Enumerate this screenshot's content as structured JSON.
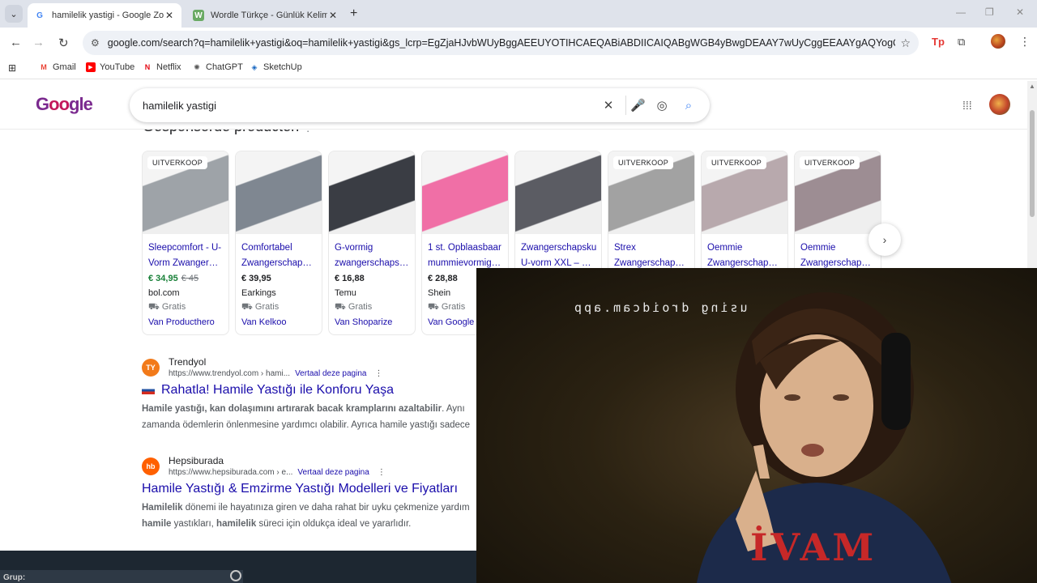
{
  "browser": {
    "tabs": [
      {
        "title": "hamilelik yastigi - Google Zoek",
        "active": true
      },
      {
        "title": "Wordle Türkçe - Günlük Kelime",
        "active": false
      }
    ],
    "url": "google.com/search?q=hamilelik+yastigi&oq=hamilelik+yastigi&gs_lcrp=EgZjaHJvbWUyBggAEEUYOTIHCAEQABiABDIICAIQABgWGB4yBwgDEAAY7wUyCggEEAAYgAQYogQyCggFEAAYgA...",
    "bookmarks": [
      {
        "label": "Gmail"
      },
      {
        "label": "YouTube"
      },
      {
        "label": "Netflix"
      },
      {
        "label": "ChatGPT"
      },
      {
        "label": "SketchUp"
      }
    ]
  },
  "google": {
    "query": "hamilelik yastigi",
    "sponsored_heading": "Gesponsorde producten",
    "products": [
      {
        "badge": "UITVERKOOP",
        "title": "Sleepcomfort - U-Vorm Zwanger…",
        "price": "€ 34,95",
        "old_price": "€ 45",
        "store": "bol.com",
        "shipping": "Gratis",
        "via": "Van Producthero",
        "color": "#9ea3a8"
      },
      {
        "badge": "",
        "title": "Comfortabel Zwangerschap…",
        "price": "€ 39,95",
        "old_price": "",
        "store": "Earkings",
        "shipping": "Gratis",
        "via": "Van Kelkoo",
        "color": "#7f8791"
      },
      {
        "badge": "",
        "title": "G-vormig zwangerschaps…",
        "price": "€ 16,88",
        "old_price": "",
        "store": "Temu",
        "shipping": "Gratis",
        "via": "Van Shoparize",
        "color": "#3a3d44"
      },
      {
        "badge": "",
        "title": "1 st. Opblaasbaar mummievormig…",
        "price": "€ 28,88",
        "old_price": "",
        "store": "Shein",
        "shipping": "Gratis",
        "via": "Van Google",
        "color": "#f06fa6"
      },
      {
        "badge": "",
        "title": "Zwangerschapsku U-vorm XXL – …",
        "price": "",
        "old_price": "",
        "store": "",
        "shipping": "",
        "via": "",
        "color": "#5b5c63"
      },
      {
        "badge": "UITVERKOOP",
        "title": "Strex Zwangerschap…",
        "price": "",
        "old_price": "",
        "store": "",
        "shipping": "",
        "via": "",
        "color": "#a2a2a2"
      },
      {
        "badge": "UITVERKOOP",
        "title": "Oemmie Zwangerschap…",
        "price": "",
        "old_price": "",
        "store": "",
        "shipping": "",
        "via": "",
        "color": "#b8a9ad"
      },
      {
        "badge": "UITVERKOOP",
        "title": "Oemmie Zwangerschap…",
        "price": "",
        "old_price": "",
        "store": "",
        "shipping": "",
        "via": "",
        "color": "#9d8d93"
      }
    ],
    "results": [
      {
        "site": "Trendyol",
        "url": "https://www.trendyol.com › hami...",
        "translate": "Vertaal deze pagina",
        "title": "Rahatla! Hamile Yastığı ile Konforu Yaşa",
        "snippet_bold": "Hamile yastığı, kan dolaşımını artırarak bacak kramplarını azaltabilir",
        "snippet_rest": ". Aynı",
        "snippet_line2": "zamanda ödemlerin önlenmesine yardımcı olabilir. Ayrıca hamile yastığı sadece",
        "fav_color": "#f27a1a",
        "fav_text": "TY"
      },
      {
        "site": "Hepsiburada",
        "url": "https://www.hepsiburada.com › e...",
        "translate": "Vertaal deze pagina",
        "title": "Hamile Yastığı & Emzirme Yastığı Modelleri ve Fiyatları",
        "snippet_bold": "Hamilelik",
        "snippet_rest": " dönemi ile hayatınıza giren ve daha rahat bir uyku çekmenize yardım",
        "snippet_line2_bold1": "hamile",
        "snippet_line2_mid": " yastıkları, ",
        "snippet_line2_bold2": "hamilelik",
        "snippet_line2_end": " süreci için oldukça ideal ve yararlıdır.",
        "fav_color": "#ff6000",
        "fav_text": "hb"
      }
    ]
  },
  "taskbar": {
    "label": "Grup:"
  },
  "webcam": {
    "watermark": "using droidcam.app",
    "hoodie_text": "İVAM"
  }
}
